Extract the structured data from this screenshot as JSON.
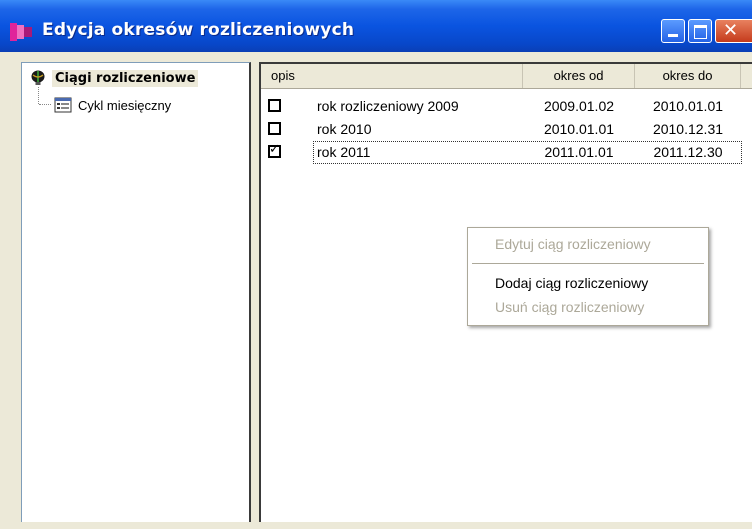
{
  "window": {
    "title": "Edycja okresów rozliczeniowych",
    "title_color": "#0a54e0",
    "close_glyph": "✕"
  },
  "tree": {
    "root_label": "Ciągi rozliczeniowe",
    "root_icon": "bulb-icon",
    "children": [
      {
        "label": "Cykl miesięczny",
        "icon": "document-list-icon"
      }
    ]
  },
  "grid": {
    "columns": [
      "opis",
      "okres od",
      "okres do"
    ],
    "rows": [
      {
        "checked": false,
        "opis": "rok rozliczeniowy 2009",
        "okres_od": "2009.01.02",
        "okres_do": "2010.01.01"
      },
      {
        "checked": false,
        "opis": "rok 2010",
        "okres_od": "2010.01.01",
        "okres_do": "2010.12.31"
      },
      {
        "checked": true,
        "opis": "rok 2011",
        "okres_od": "2011.01.01",
        "okres_do": "2011.12.30"
      }
    ]
  },
  "context_menu": {
    "items": [
      {
        "label": "Edytuj ciąg rozliczeniowy",
        "enabled": false
      },
      {
        "label": "Dodaj ciąg rozliczeniowy",
        "enabled": true
      },
      {
        "label": "Usuń ciąg rozliczeniowy",
        "enabled": false
      }
    ]
  },
  "check_glyph": "✓"
}
